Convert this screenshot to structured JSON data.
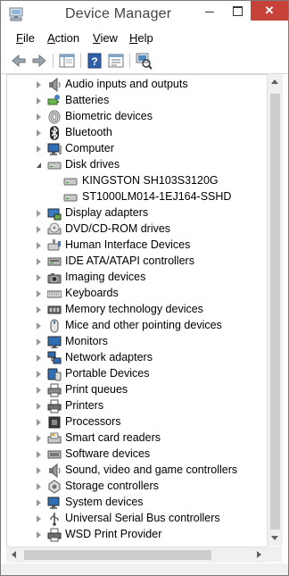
{
  "window": {
    "title": "Device Manager",
    "close_glyph": "✕"
  },
  "menu": [
    {
      "label": "File",
      "access_key": "F"
    },
    {
      "label": "Action",
      "access_key": "A"
    },
    {
      "label": "View",
      "access_key": "V"
    },
    {
      "label": "Help",
      "access_key": "H"
    }
  ],
  "toolbar": {
    "buttons": [
      "back-arrow-icon",
      "forward-arrow-icon",
      "show-hide-console-tree-icon",
      "help-icon",
      "properties-icon",
      "scan-hardware-icon"
    ]
  },
  "tree": {
    "items": [
      {
        "label": "Audio inputs and outputs",
        "icon": "speaker-icon",
        "state": "collapsed",
        "depth": 0
      },
      {
        "label": "Batteries",
        "icon": "battery-icon",
        "state": "collapsed",
        "depth": 0
      },
      {
        "label": "Biometric devices",
        "icon": "fingerprint-icon",
        "state": "collapsed",
        "depth": 0
      },
      {
        "label": "Bluetooth",
        "icon": "bluetooth-icon",
        "state": "collapsed",
        "depth": 0
      },
      {
        "label": "Computer",
        "icon": "computer-icon",
        "state": "collapsed",
        "depth": 0
      },
      {
        "label": "Disk drives",
        "icon": "disk-drive-icon",
        "state": "expanded",
        "depth": 0
      },
      {
        "label": "KINGSTON SH103S3120G",
        "icon": "disk-drive-icon",
        "state": "leaf",
        "depth": 1
      },
      {
        "label": "ST1000LM014-1EJ164-SSHD",
        "icon": "disk-drive-icon",
        "state": "leaf",
        "depth": 1
      },
      {
        "label": "Display adapters",
        "icon": "display-adapter-icon",
        "state": "collapsed",
        "depth": 0
      },
      {
        "label": "DVD/CD-ROM drives",
        "icon": "dvd-drive-icon",
        "state": "collapsed",
        "depth": 0
      },
      {
        "label": "Human Interface Devices",
        "icon": "hid-icon",
        "state": "collapsed",
        "depth": 0
      },
      {
        "label": "IDE ATA/ATAPI controllers",
        "icon": "ide-controller-icon",
        "state": "collapsed",
        "depth": 0
      },
      {
        "label": "Imaging devices",
        "icon": "camera-icon",
        "state": "collapsed",
        "depth": 0
      },
      {
        "label": "Keyboards",
        "icon": "keyboard-icon",
        "state": "collapsed",
        "depth": 0
      },
      {
        "label": "Memory technology devices",
        "icon": "memory-icon",
        "state": "collapsed",
        "depth": 0
      },
      {
        "label": "Mice and other pointing devices",
        "icon": "mouse-icon",
        "state": "collapsed",
        "depth": 0
      },
      {
        "label": "Monitors",
        "icon": "monitor-icon",
        "state": "collapsed",
        "depth": 0
      },
      {
        "label": "Network adapters",
        "icon": "network-adapter-icon",
        "state": "collapsed",
        "depth": 0
      },
      {
        "label": "Portable Devices",
        "icon": "portable-device-icon",
        "state": "collapsed",
        "depth": 0
      },
      {
        "label": "Print queues",
        "icon": "print-queue-icon",
        "state": "collapsed",
        "depth": 0
      },
      {
        "label": "Printers",
        "icon": "printer-icon",
        "state": "collapsed",
        "depth": 0
      },
      {
        "label": "Processors",
        "icon": "processor-icon",
        "state": "collapsed",
        "depth": 0
      },
      {
        "label": "Smart card readers",
        "icon": "smart-card-icon",
        "state": "collapsed",
        "depth": 0
      },
      {
        "label": "Software devices",
        "icon": "software-device-icon",
        "state": "collapsed",
        "depth": 0
      },
      {
        "label": "Sound, video and game controllers",
        "icon": "sound-controller-icon",
        "state": "collapsed",
        "depth": 0
      },
      {
        "label": "Storage controllers",
        "icon": "storage-controller-icon",
        "state": "collapsed",
        "depth": 0
      },
      {
        "label": "System devices",
        "icon": "system-device-icon",
        "state": "collapsed",
        "depth": 0
      },
      {
        "label": "Universal Serial Bus controllers",
        "icon": "usb-icon",
        "state": "collapsed",
        "depth": 0
      },
      {
        "label": "WSD Print Provider",
        "icon": "printer-icon",
        "state": "collapsed",
        "depth": 0
      }
    ]
  },
  "colors": {
    "close_button": "#c7433a",
    "title_text": "#444444"
  }
}
